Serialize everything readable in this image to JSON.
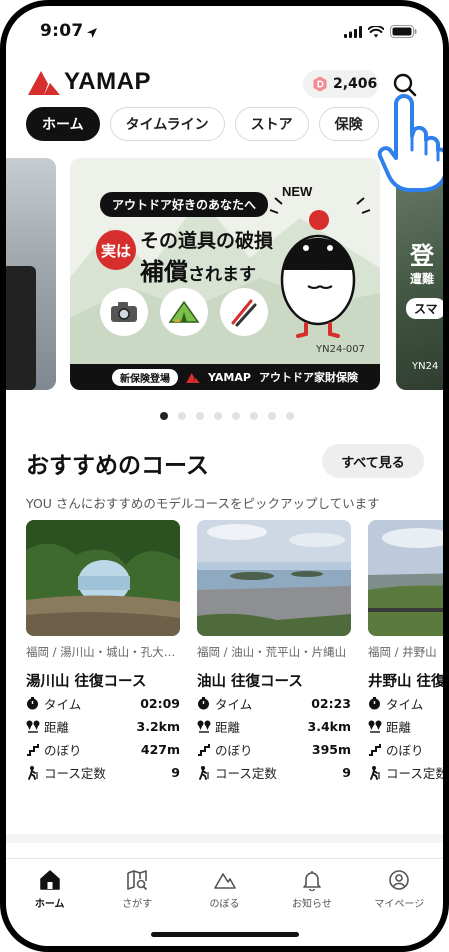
{
  "status_bar": {
    "time": "9:07"
  },
  "header": {
    "brand": "YAMAP",
    "points": "2,406"
  },
  "tabs": [
    {
      "label": "ホーム",
      "active": true
    },
    {
      "label": "タイムライン",
      "active": false
    },
    {
      "label": "ストア",
      "active": false
    },
    {
      "label": "保険",
      "active": false
    }
  ],
  "banner": {
    "lead": "アウトドア好きのあなたへ",
    "badge": "実は",
    "headline1": "その道具の破損",
    "headline2a": "補償",
    "headline2b": "されます",
    "new_tag": "NEW",
    "code": "YN24-007",
    "footer_pill": "新保険登場",
    "footer_brand": "YAMAP",
    "footer_text": "アウトドア家財保険"
  },
  "side_banner": {
    "title": "登",
    "sub": "遭難",
    "pill": "スマ",
    "code": "YN24"
  },
  "carousel": {
    "dot_count": 8,
    "active_index": 0
  },
  "recommended": {
    "title": "おすすめのコース",
    "see_all": "すべて見る",
    "subtitle": "YOU さんにおすすめのモデルコースをピックアップしています",
    "stat_labels": {
      "time": "タイム",
      "distance": "距離",
      "climb": "のぼり",
      "constant": "コース定数"
    },
    "courses": [
      {
        "area": "福岡 / 湯川山・城山・孔大寺山",
        "name": "湯川山 往復コース",
        "time": "02:09",
        "distance": "3.2km",
        "climb": "427m",
        "constant": "9"
      },
      {
        "area": "福岡 / 油山・荒平山・片縄山",
        "name": "油山 往復コース",
        "time": "02:23",
        "distance": "3.4km",
        "climb": "395m",
        "constant": "9"
      },
      {
        "area": "福岡 / 井野山",
        "name": "井野山 往復",
        "time": "",
        "distance": "",
        "climb": "",
        "constant": ""
      }
    ]
  },
  "bottom_nav": [
    {
      "label": "ホーム",
      "icon": "home-icon",
      "active": true
    },
    {
      "label": "さがす",
      "icon": "map-search-icon",
      "active": false
    },
    {
      "label": "のぼる",
      "icon": "mountain-icon",
      "active": false
    },
    {
      "label": "お知らせ",
      "icon": "bell-icon",
      "active": false
    },
    {
      "label": "マイページ",
      "icon": "user-circle-icon",
      "active": false
    }
  ],
  "colors": {
    "brand_red": "#d62d2d",
    "accent_blue": "#2f80ed",
    "active_tab_bg": "#111111"
  }
}
